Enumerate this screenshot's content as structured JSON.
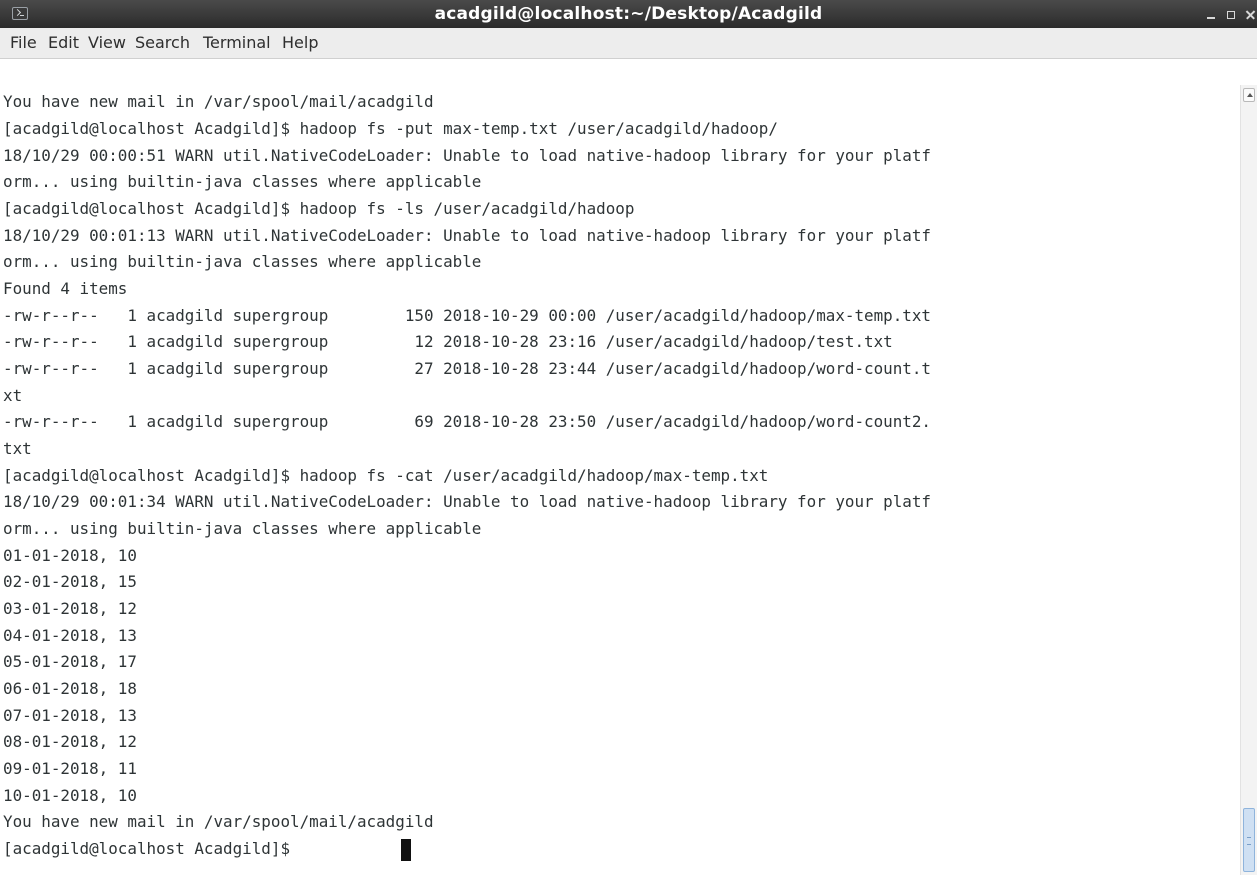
{
  "window": {
    "title": "acadgild@localhost:~/Desktop/Acadgild",
    "icon": "terminal-icon",
    "controls": [
      "minimize-icon",
      "maximize-icon",
      "close-icon"
    ]
  },
  "menu": {
    "items": [
      "File",
      "Edit",
      "View",
      "Search",
      "Terminal",
      "Help"
    ]
  },
  "terminal": {
    "lines": [
      "You have new mail in /var/spool/mail/acadgild",
      "[acadgild@localhost Acadgild]$ hadoop fs -put max-temp.txt /user/acadgild/hadoop/",
      "18/10/29 00:00:51 WARN util.NativeCodeLoader: Unable to load native-hadoop library for your platf",
      "orm... using builtin-java classes where applicable",
      "[acadgild@localhost Acadgild]$ hadoop fs -ls /user/acadgild/hadoop",
      "18/10/29 00:01:13 WARN util.NativeCodeLoader: Unable to load native-hadoop library for your platf",
      "orm... using builtin-java classes where applicable",
      "Found 4 items",
      "-rw-r--r--   1 acadgild supergroup        150 2018-10-29 00:00 /user/acadgild/hadoop/max-temp.txt",
      "-rw-r--r--   1 acadgild supergroup         12 2018-10-28 23:16 /user/acadgild/hadoop/test.txt",
      "-rw-r--r--   1 acadgild supergroup         27 2018-10-28 23:44 /user/acadgild/hadoop/word-count.t",
      "xt",
      "-rw-r--r--   1 acadgild supergroup         69 2018-10-28 23:50 /user/acadgild/hadoop/word-count2.",
      "txt",
      "[acadgild@localhost Acadgild]$ hadoop fs -cat /user/acadgild/hadoop/max-temp.txt",
      "18/10/29 00:01:34 WARN util.NativeCodeLoader: Unable to load native-hadoop library for your platf",
      "orm... using builtin-java classes where applicable",
      "01-01-2018, 10",
      "02-01-2018, 15",
      "03-01-2018, 12",
      "04-01-2018, 13",
      "05-01-2018, 17",
      "06-01-2018, 18",
      "07-01-2018, 13",
      "08-01-2018, 12",
      "09-01-2018, 11",
      "10-01-2018, 10",
      "You have new mail in /var/spool/mail/acadgild",
      "[acadgild@localhost Acadgild]$ "
    ]
  }
}
